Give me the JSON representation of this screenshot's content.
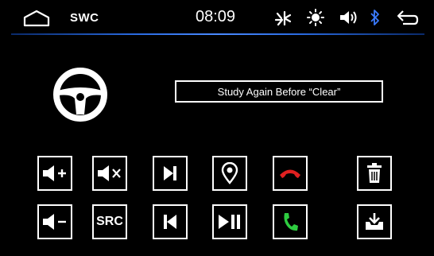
{
  "statusbar": {
    "title": "SWC",
    "time": "08:09"
  },
  "message": {
    "text": "Study  Again Before  “Clear”"
  },
  "buttons": {
    "src_label": "SRC"
  },
  "colors": {
    "hangup": "#e02020",
    "answer": "#2ecc40",
    "bluetooth": "#3a7bff",
    "accent_line": "#2a6ae0"
  },
  "icons": [
    "home-icon",
    "steering-wheel-icon",
    "brightness-icon",
    "volume-icon",
    "bluetooth-icon",
    "back-icon",
    "volume-up-icon",
    "volume-down-icon",
    "mute-icon",
    "next-track-icon",
    "previous-track-icon",
    "navigation-icon",
    "play-pause-icon",
    "hang-up-icon",
    "answer-call-icon",
    "delete-icon",
    "save-icon"
  ]
}
